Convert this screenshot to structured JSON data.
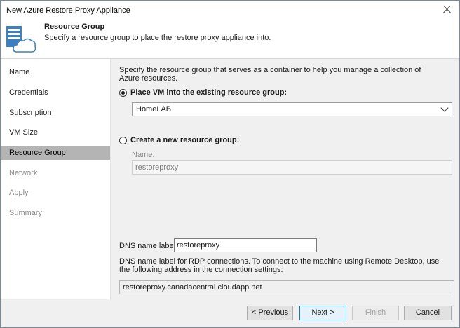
{
  "window": {
    "title": "New Azure Restore Proxy Appliance"
  },
  "header": {
    "title": "Resource Group",
    "subtitle": "Specify a resource group to place the restore proxy appliance into."
  },
  "sidebar": {
    "items": [
      {
        "label": "Name",
        "state": "normal"
      },
      {
        "label": "Credentials",
        "state": "normal"
      },
      {
        "label": "Subscription",
        "state": "normal"
      },
      {
        "label": "VM Size",
        "state": "normal"
      },
      {
        "label": "Resource Group",
        "state": "active"
      },
      {
        "label": "Network",
        "state": "disabled"
      },
      {
        "label": "Apply",
        "state": "disabled"
      },
      {
        "label": "Summary",
        "state": "disabled"
      }
    ]
  },
  "main": {
    "description": "Specify the resource group that serves as a container to help you manage a collection of Azure resources.",
    "existing_option": {
      "label": "Place VM into the existing resource group:",
      "selected": true
    },
    "existing_group": {
      "value": "HomeLAB"
    },
    "new_option": {
      "label": "Create a new resource group:",
      "selected": false
    },
    "new_group": {
      "name_label": "Name:",
      "value": "restoreproxy"
    },
    "dns": {
      "label": "DNS name label:",
      "value": "restoreproxy",
      "description": "DNS name label for RDP connections. To connect to the machine using Remote Desktop, use the following address in the connection settings:",
      "address": "restoreproxy.canadacentral.cloudapp.net"
    }
  },
  "footer": {
    "previous_label": "< Previous",
    "next_label": "Next >",
    "finish_label": "Finish",
    "cancel_label": "Cancel"
  },
  "colors": {
    "active_nav": "#b4b4b4",
    "accent": "#0078d7",
    "icon_blue": "#3d7fc1"
  },
  "icons": {
    "close": "close-icon",
    "wizard": "server-cloud-icon",
    "dropdown": "chevron-down-icon"
  }
}
